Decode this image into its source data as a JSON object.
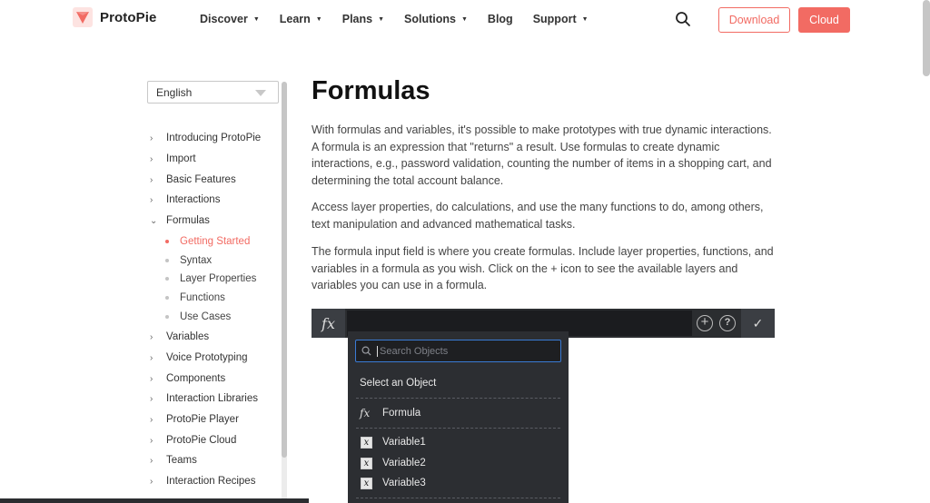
{
  "header": {
    "logo_text": "ProtoPie",
    "nav": [
      {
        "label": "Discover",
        "has_caret": true
      },
      {
        "label": "Learn",
        "has_caret": true
      },
      {
        "label": "Plans",
        "has_caret": true
      },
      {
        "label": "Solutions",
        "has_caret": true
      },
      {
        "label": "Blog",
        "has_caret": false
      },
      {
        "label": "Support",
        "has_caret": true
      }
    ],
    "download_label": "Download",
    "cloud_label": "Cloud",
    "accent_color": "#f26b63"
  },
  "sidebar": {
    "language": "English",
    "items": [
      {
        "label": "Introducing ProtoPie",
        "chev": "›"
      },
      {
        "label": "Import",
        "chev": "›"
      },
      {
        "label": "Basic Features",
        "chev": "›"
      },
      {
        "label": "Interactions",
        "chev": "›"
      },
      {
        "label": "Formulas",
        "chev": "⌄"
      },
      {
        "label": "Variables",
        "chev": "›"
      },
      {
        "label": "Voice Prototyping",
        "chev": "›"
      },
      {
        "label": "Components",
        "chev": "›"
      },
      {
        "label": "Interaction Libraries",
        "chev": "›"
      },
      {
        "label": "ProtoPie Player",
        "chev": "›"
      },
      {
        "label": "ProtoPie Cloud",
        "chev": "›"
      },
      {
        "label": "Teams",
        "chev": "›"
      },
      {
        "label": "Interaction Recipes",
        "chev": "›"
      }
    ],
    "sub_items": [
      {
        "label": "Getting Started",
        "active": true
      },
      {
        "label": "Syntax",
        "active": false
      },
      {
        "label": "Layer Properties",
        "active": false
      },
      {
        "label": "Functions",
        "active": false
      },
      {
        "label": "Use Cases",
        "active": false
      }
    ]
  },
  "main": {
    "title": "Formulas",
    "paragraphs": [
      "With formulas and variables, it's possible to make prototypes with true dynamic interactions. A formula is an expression that \"returns\" a result. Use formulas to create dynamic interactions, e.g., password validation, counting the number of items in a shopping cart, and determining the total account balance.",
      "Access layer properties, do calculations, and use the many functions to do, among others, text manipulation and advanced mathematical tasks.",
      "The formula input field is where you create formulas. Include layer properties, functions, and variables in a formula as you wish. Click on the + icon to see the available layers and variables you can use in a formula."
    ]
  },
  "formula_ui": {
    "fx_glyph": "fx",
    "plus_glyph": "+",
    "help_glyph": "?",
    "check_glyph": "✓",
    "search_placeholder": "Search Objects",
    "heading": "Select an Object",
    "formula_item": "Formula",
    "variables": [
      "Variable1",
      "Variable2",
      "Variable3"
    ],
    "var_glyph": "x"
  }
}
